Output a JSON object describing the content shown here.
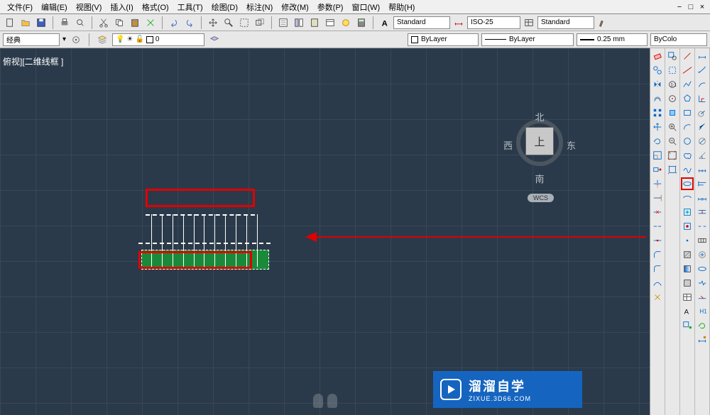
{
  "menu": {
    "file": "文件(F)",
    "edit": "编辑(E)",
    "view": "视图(V)",
    "insert": "插入(I)",
    "format": "格式(O)",
    "tools": "工具(T)",
    "draw": "绘图(D)",
    "dimension": "标注(N)",
    "modify": "修改(M)",
    "param": "参数(P)",
    "window": "窗口(W)",
    "help": "帮助(H)"
  },
  "toolbar1": {
    "workspace": "经典",
    "text_style": "Standard",
    "dim_style": "ISO-25",
    "table_style": "Standard"
  },
  "toolbar2": {
    "layer": "0",
    "bylayer1": "ByLayer",
    "bylayer2": "ByLayer",
    "linewidth": "0.25 mm",
    "bycolo": "ByColo"
  },
  "viewport": {
    "label": "俯视][二维线框 ]"
  },
  "viewcube": {
    "n": "北",
    "s": "南",
    "w": "西",
    "e": "东",
    "top": "上",
    "wcs": "WCS"
  },
  "watermark": {
    "main": "溜溜自学",
    "sub": "ZIXUE.3D66.COM"
  },
  "icons": {
    "new": "new",
    "open": "open",
    "save": "save",
    "print": "print",
    "cut": "cut",
    "copy": "copy",
    "paste": "paste",
    "undo": "undo",
    "redo": "redo"
  }
}
